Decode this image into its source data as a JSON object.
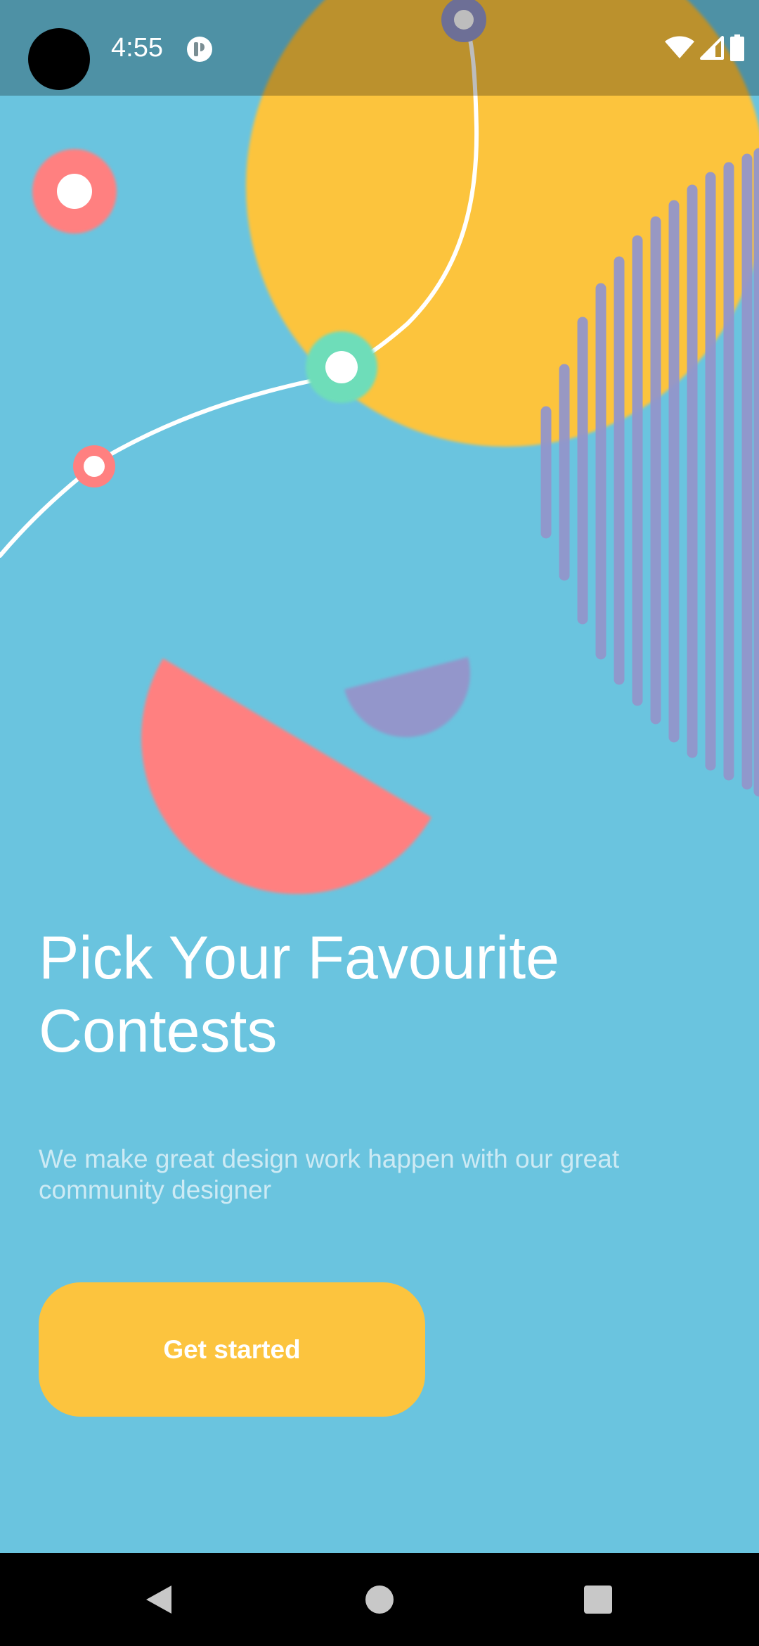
{
  "status_bar": {
    "time": "4:55",
    "icons": [
      "app-notification-icon",
      "wifi-icon",
      "signal-icon",
      "battery-icon"
    ]
  },
  "onboarding": {
    "headline": "Pick Your Favourite Contests",
    "subtitle": "We make great design work happen with our great community designer",
    "cta_label": "Get started"
  },
  "colors": {
    "background": "#6AC4DF",
    "accent_yellow": "#FCC43E",
    "accent_coral": "#FF8080",
    "accent_purple": "#9396CB",
    "accent_mint": "#6EDDB9",
    "text_primary": "#FFFFFF",
    "text_secondary": "#CDEAF4"
  },
  "navigation_bar": {
    "buttons": [
      "back-icon",
      "home-icon",
      "recents-icon"
    ]
  }
}
